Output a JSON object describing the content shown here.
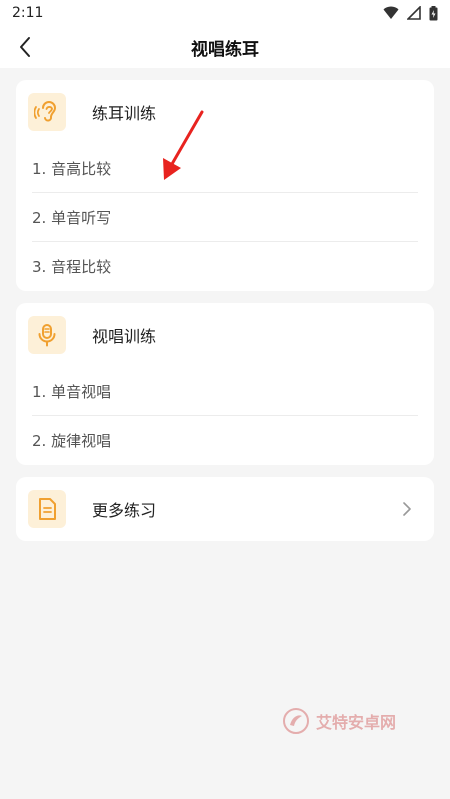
{
  "status": {
    "time": "2:11"
  },
  "header": {
    "title": "视唱练耳"
  },
  "ear_training": {
    "title": "练耳训练",
    "icon": "ear-icon",
    "items": [
      {
        "label": "1. 音高比较"
      },
      {
        "label": "2. 单音听写"
      },
      {
        "label": "3. 音程比较"
      }
    ]
  },
  "sight_singing": {
    "title": "视唱训练",
    "icon": "microphone-icon",
    "items": [
      {
        "label": "1. 单音视唱"
      },
      {
        "label": "2. 旋律视唱"
      }
    ]
  },
  "more": {
    "title": "更多练习",
    "icon": "document-icon"
  },
  "watermark": {
    "text": "艾特安卓网"
  },
  "colors": {
    "accent": "#f0a030",
    "icon_bg": "#fdf0d8",
    "arrow": "#e8231f",
    "background": "#f5f5f5"
  }
}
